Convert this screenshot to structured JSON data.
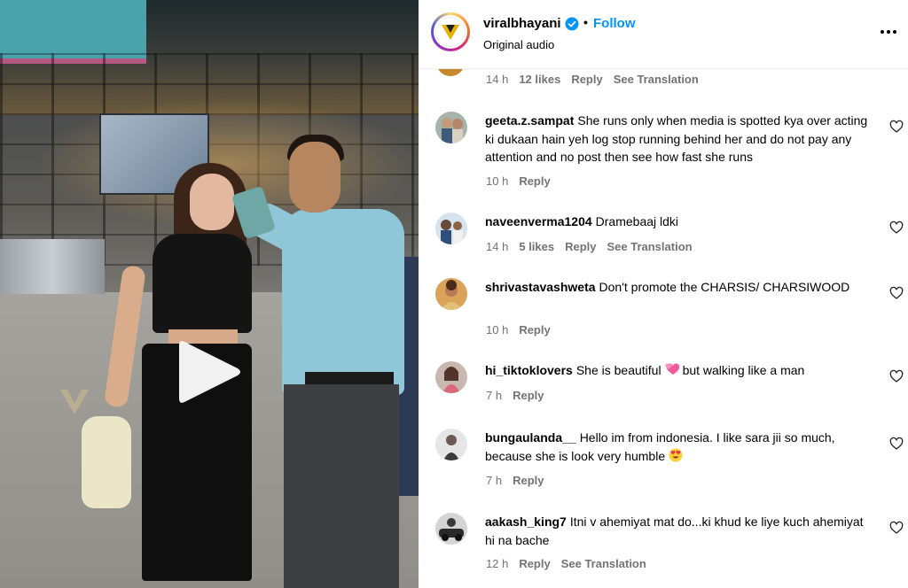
{
  "post": {
    "username": "viralbhayani",
    "follow_label": "Follow",
    "separator": "•",
    "audio": "Original audio"
  },
  "icons": {
    "verified": "verified-badge-icon",
    "more": "more-options-icon",
    "play": "play-icon",
    "like": "heart-icon"
  },
  "colors": {
    "follow": "#0095f6",
    "verified": "#0095f6",
    "meta_text": "#737373"
  },
  "previous_comment_meta": {
    "time": "14 h",
    "likes": "12 likes",
    "reply": "Reply",
    "translation": "See Translation"
  },
  "comments": [
    {
      "user": "geeta.z.sampat",
      "text": "She runs only when media is spotted kya over acting ki dukaan hain yeh log stop running behind her and do not pay any attention and no post then see how fast she runs",
      "time": "10 h",
      "reply": "Reply"
    },
    {
      "user": "naveenverma1204",
      "text": "Dramebaaj ldki",
      "time": "14 h",
      "likes": "5 likes",
      "reply": "Reply",
      "translation": "See Translation"
    },
    {
      "user": "shrivastavashweta",
      "text": "Don't promote the CHARSIS/ CHARSIWOOD",
      "time": "10 h",
      "reply": "Reply"
    },
    {
      "user": "hi_tiktoklovers",
      "text_before": "She is beautiful",
      "emoji": "two-hearts-emoji",
      "text_after": "but walking like a man",
      "time": "7 h",
      "reply": "Reply"
    },
    {
      "user": "bungaulanda__",
      "text": "Hello im from indonesia. I like sara jii so much, because she is look very humble",
      "emoji": "heart-eyes-emoji",
      "time": "7 h",
      "reply": "Reply"
    },
    {
      "user": "aakash_king7",
      "text": "Itni v ahemiyat mat do...ki khud ke liye kuch ahemiyat hi na bache",
      "time": "12 h",
      "reply": "Reply",
      "translation": "See Translation"
    }
  ]
}
